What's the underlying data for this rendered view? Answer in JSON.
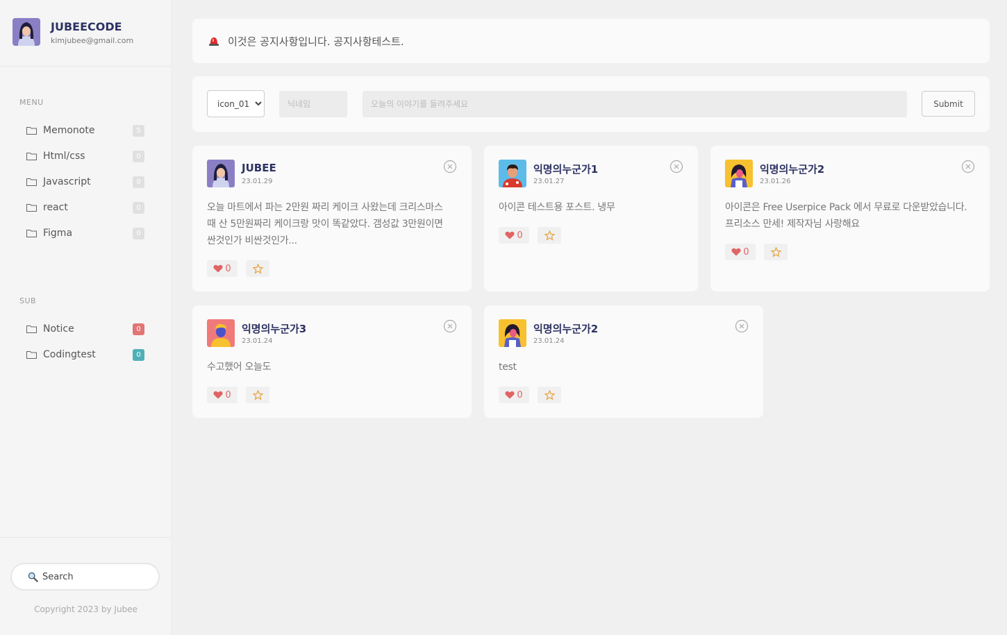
{
  "profile": {
    "name": "JUBEECODE",
    "email": "kimjubee@gmail.com"
  },
  "menu": {
    "title": "MENU",
    "items": [
      {
        "label": "Memonote",
        "count": "5"
      },
      {
        "label": "Html/css",
        "count": "0"
      },
      {
        "label": "Javascript",
        "count": "0"
      },
      {
        "label": "react",
        "count": "0"
      },
      {
        "label": "Figma",
        "count": "0"
      }
    ]
  },
  "sub": {
    "title": "SUB",
    "items": [
      {
        "label": "Notice",
        "count": "0",
        "color": "#e27474"
      },
      {
        "label": "Codingtest",
        "count": "0",
        "color": "#4fb0b8"
      }
    ]
  },
  "search": {
    "placeholder": "Search"
  },
  "copyright": "Copyright 2023 by Jubee",
  "notice": {
    "text": "이것은 공지사항입니다. 공지사항테스트.",
    "icon": "siren-icon"
  },
  "form": {
    "icon_select": "icon_01",
    "nickname_placeholder": "닉네임",
    "story_placeholder": "오늘의 이야기를 들려주세요",
    "submit_label": "Submit"
  },
  "posts": [
    {
      "name": "JUBEE",
      "date": "23.01.29",
      "body_lines": [
        "오늘 마트에서 파는 2만원 짜리 케이크 사왔는데 크리스마스",
        "때 산 5만원짜리 케이크랑 맛이 똑같았다. 갬성값 3만원이면",
        "싼것인가 비싼것인가..."
      ],
      "likes": "0",
      "avatar": "woman-purple"
    },
    {
      "name": "익명의누군가1",
      "date": "23.01.27",
      "body_lines": [
        "아이콘 테스트용 포스트. 냉무"
      ],
      "likes": "0",
      "avatar": "man-blue"
    },
    {
      "name": "익명의누군가2",
      "date": "23.01.26",
      "body_lines": [
        "아이콘은 Free Userpice Pack 에서 무료로 다운받았습니다.",
        "프리소스 만세! 제작자님 사랑해요"
      ],
      "likes": "0",
      "avatar": "woman-yellow"
    },
    {
      "name": "익명의누군가3",
      "date": "23.01.24",
      "body_lines": [
        "수고했어 오늘도"
      ],
      "likes": "0",
      "avatar": "man-pink"
    },
    {
      "name": "익명의누군가2",
      "date": "23.01.24",
      "body_lines": [
        "test"
      ],
      "likes": "0",
      "avatar": "woman-yellow"
    }
  ]
}
